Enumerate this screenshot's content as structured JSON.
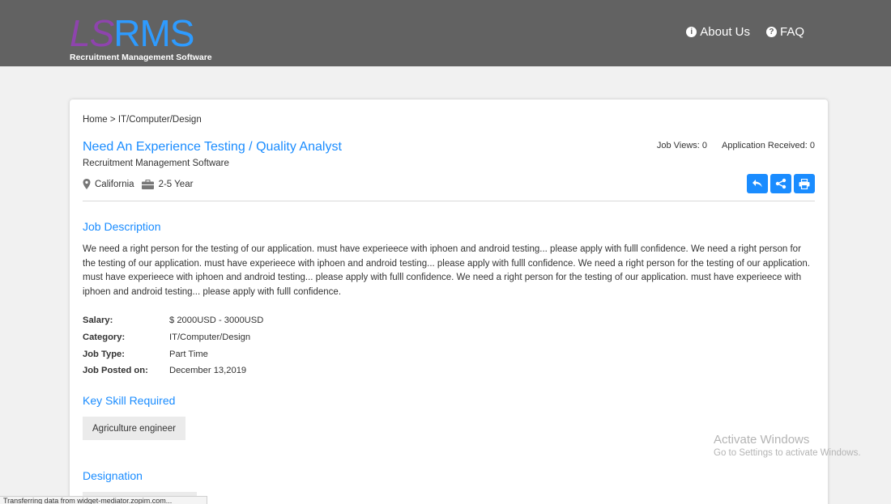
{
  "header": {
    "logo": {
      "mark_ls": "LS",
      "mark_rms": "RMS",
      "tagline": "Recruitment Management Software"
    },
    "nav": [
      {
        "label": "About Us",
        "icon": "info-icon"
      },
      {
        "label": "FAQ",
        "icon": "question-icon"
      }
    ]
  },
  "job": {
    "breadcrumb": {
      "home": "Home",
      "sep": ">",
      "category": "IT/Computer/Design"
    },
    "title": "Need An Experience Testing / Quality Analyst",
    "company": "Recruitment Management Software",
    "location": "California",
    "experience": "2-5 Year",
    "views": "Job Views: 0",
    "applications": "Application Received: 0",
    "actions": [
      "reply-icon",
      "share-icon",
      "print-icon"
    ],
    "description_heading": "Job Description",
    "description": "We need a right person for the testing of our application. must have experieece with iphoen and android  testing... please apply with fulll confidence. We need a right person for the testing of our application. must have experieece with iphoen and android  testing... please apply with fulll confidence. We need a right person for the testing of our application. must have experieece with iphoen and android  testing... please apply with fulll confidence. We need a right person for the testing of our application. must have experieece with iphoen and android  testing... please apply with fulll confidence.",
    "details": [
      {
        "label": "Salary:",
        "value": "$ 2000USD - 3000USD"
      },
      {
        "label": "Category:",
        "value": "IT/Computer/Design"
      },
      {
        "label": "Job Type:",
        "value": "Part Time"
      },
      {
        "label": "Job Posted on:",
        "value": "December 13,2019"
      }
    ],
    "skills_heading": "Key Skill Required",
    "skills": [
      "Agriculture engineer"
    ],
    "designation_heading": "Designation"
  },
  "overlay": {
    "activate_title": "Activate Windows",
    "activate_sub": "Go to Settings to activate Windows.",
    "status": "Transferring data from widget-mediator.zopim.com..."
  },
  "colors": {
    "header_bg": "#626262",
    "accent": "#1a8cff",
    "page_bg": "#f1f1f1"
  }
}
